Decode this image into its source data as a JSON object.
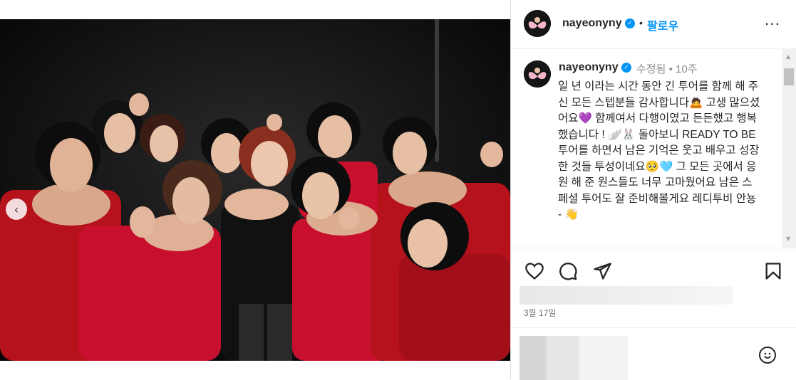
{
  "post": {
    "carousel": {
      "slide_count": 6,
      "active_index": 5
    },
    "photo": {
      "background": "#0a0a0a",
      "accent": "#c8102e"
    }
  },
  "header": {
    "username": "nayeonyny",
    "verified": true,
    "follow_label": "팔로우",
    "more_label": "···"
  },
  "caption": {
    "username": "nayeonyny",
    "edited_label": "수정됨",
    "separator": "•",
    "time_ago": "10주",
    "text": "일 년 이라는 시간 동안 긴 투어를 함께 해 주신 모든 스텝분들 감사합니다🙇 고생 많으셨어요💜 함께여서 다행이였고 든든했고 행복했습니다 ! 🪽🐰 돌아보니 READY TO BE 투어를 하면서 남은 기억은 웃고 배우고 성장한 것들 투성이네요🥺🩵 그 모든 곳에서 응원 해 준 원스들도 너무 고마웠어요 남은 스페셜 투어도 잘 준비해볼게요 레디투비 안뇽 - 👋"
  },
  "actions": {
    "like_icon": "heart-icon",
    "comment_icon": "comment-icon",
    "share_icon": "send-icon",
    "save_icon": "bookmark-icon"
  },
  "post_date": "3월 17일",
  "comment": {
    "emoji_icon": "smile-icon"
  },
  "colors": {
    "accent_blue": "#0095f6",
    "text": "#262626",
    "muted": "#8e8e8e",
    "border": "#dbdbdb"
  }
}
